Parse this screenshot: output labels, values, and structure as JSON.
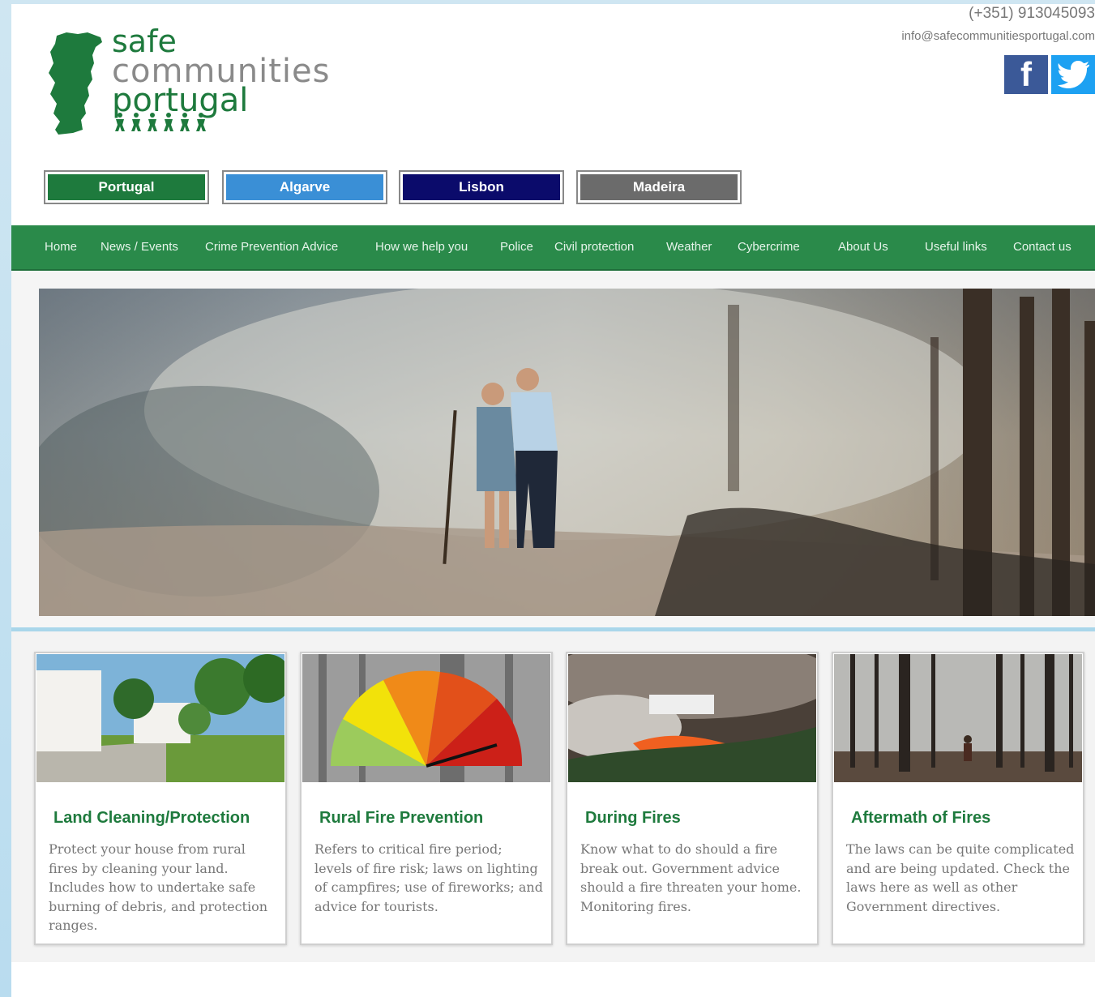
{
  "header": {
    "logo": {
      "line1": "safe",
      "line2": "communities",
      "line3": "portugal"
    },
    "phone": "(+351) 913045093",
    "email": "info@safecommunitiesportugal.com",
    "social": [
      {
        "name": "facebook",
        "glyph": "f"
      },
      {
        "name": "twitter"
      }
    ]
  },
  "regions": [
    {
      "label": "Portugal",
      "color": "#1e7a3d"
    },
    {
      "label": "Algarve",
      "color": "#3a8fd6"
    },
    {
      "label": "Lisbon",
      "color": "#0b0b6b"
    },
    {
      "label": "Madeira",
      "color": "#6b6b6b"
    }
  ],
  "nav": {
    "items": [
      "Home",
      "News / Events",
      "Crime Prevention Advice",
      "How we help you",
      "Police",
      "Civil protection",
      "Weather",
      "Cybercrime",
      "About Us",
      "Useful links",
      "Contact us"
    ]
  },
  "cards": [
    {
      "title": "Land Cleaning/Protection",
      "text": "Protect your house from rural fires by cleaning your land. Includes how to undertake safe burning of debris, and protection ranges."
    },
    {
      "title": "Rural Fire Prevention",
      "text": "Refers to critical fire period; levels of fire risk; laws on lighting of campfires; use of fireworks; and advice for tourists."
    },
    {
      "title": "During Fires",
      "text": "Know what to do should a fire break out. Government advice should a fire threaten your home. Monitoring fires."
    },
    {
      "title": "Aftermath of Fires",
      "text": "The laws can be quite complicated and are being updated. Check the laws here as well as other Government directives."
    }
  ],
  "colors": {
    "brand_green": "#1e7a3d",
    "nav_green": "#2a8a4a",
    "accent_blue": "#a9d6ea"
  }
}
